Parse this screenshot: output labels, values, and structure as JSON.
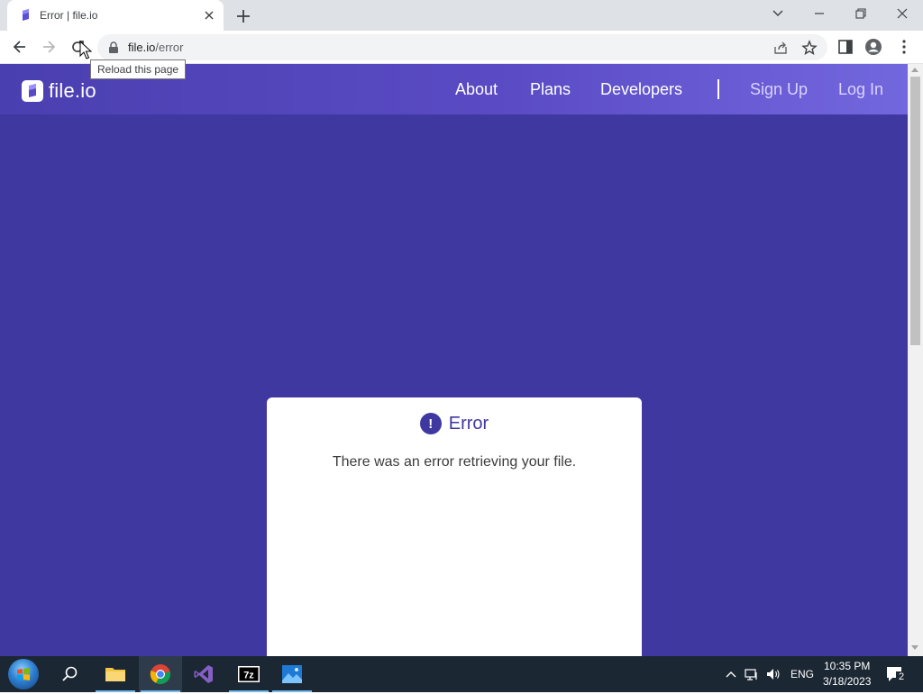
{
  "browser": {
    "tab_title": "Error | file.io",
    "url_host": "file.io",
    "url_path": "/error",
    "reload_tooltip": "Reload this page"
  },
  "site": {
    "brand": "file.io",
    "nav": {
      "about": "About",
      "plans": "Plans",
      "developers": "Developers",
      "sign_up": "Sign Up",
      "log_in": "Log In"
    },
    "colors": {
      "page_bg": "#3f38a0",
      "header_end": "#7367de",
      "accent": "#3f38a0"
    }
  },
  "error_card": {
    "title": "Error",
    "message": "There was an error retrieving your file."
  },
  "taskbar": {
    "apps": [
      "start-button",
      "search",
      "file-explorer",
      "chrome",
      "visual-studio",
      "7-zip",
      "photos"
    ],
    "language": "ENG",
    "time": "10:35 PM",
    "date": "3/18/2023",
    "notification_count": "2"
  }
}
